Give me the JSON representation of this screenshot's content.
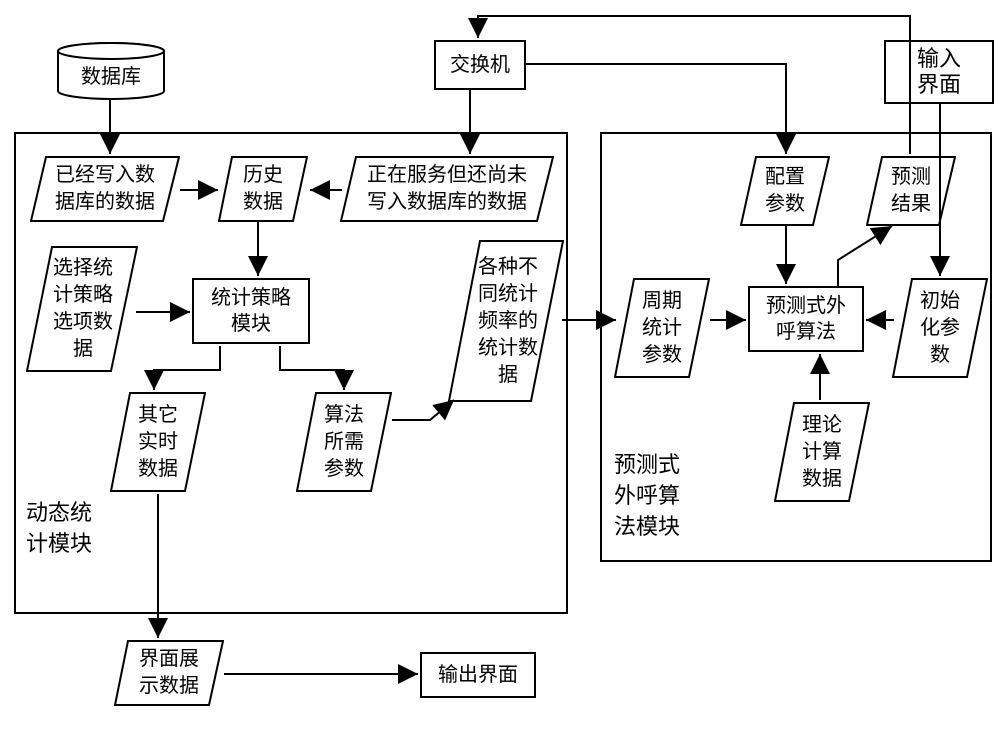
{
  "top": {
    "database": "数据库",
    "switch": "交换机",
    "input_interface": "输入界面"
  },
  "stat_module": {
    "label": "动态统\n计模块",
    "written_data": "已经写入数\n据库的数据",
    "history_data": "历史\n数据",
    "in_service_data": "正在服务但还尚未\n写入数据库的数据",
    "select_strategy": "选择统\n计策略\n选项数\n据",
    "strategy_module": "统计策略\n模块",
    "various_stat": "各种不\n同统计\n频率的\n统计数\n据",
    "other_rt": "其它\n实时\n数据",
    "algo_params": "算法\n所需\n参数",
    "display_data": "界面展\n示数据",
    "output_interface": "输出界面"
  },
  "pred_module": {
    "label": "预测式\n外呼算\n法模块",
    "config_params": "配置\n参数",
    "predict_result": "预测\n结果",
    "cycle_stat": "周期\n统计\n参数",
    "predictive_algo": "预测式外\n呼算法",
    "init_params": "初始\n化参\n数",
    "theory_data": "理论\n计算\n数据"
  }
}
